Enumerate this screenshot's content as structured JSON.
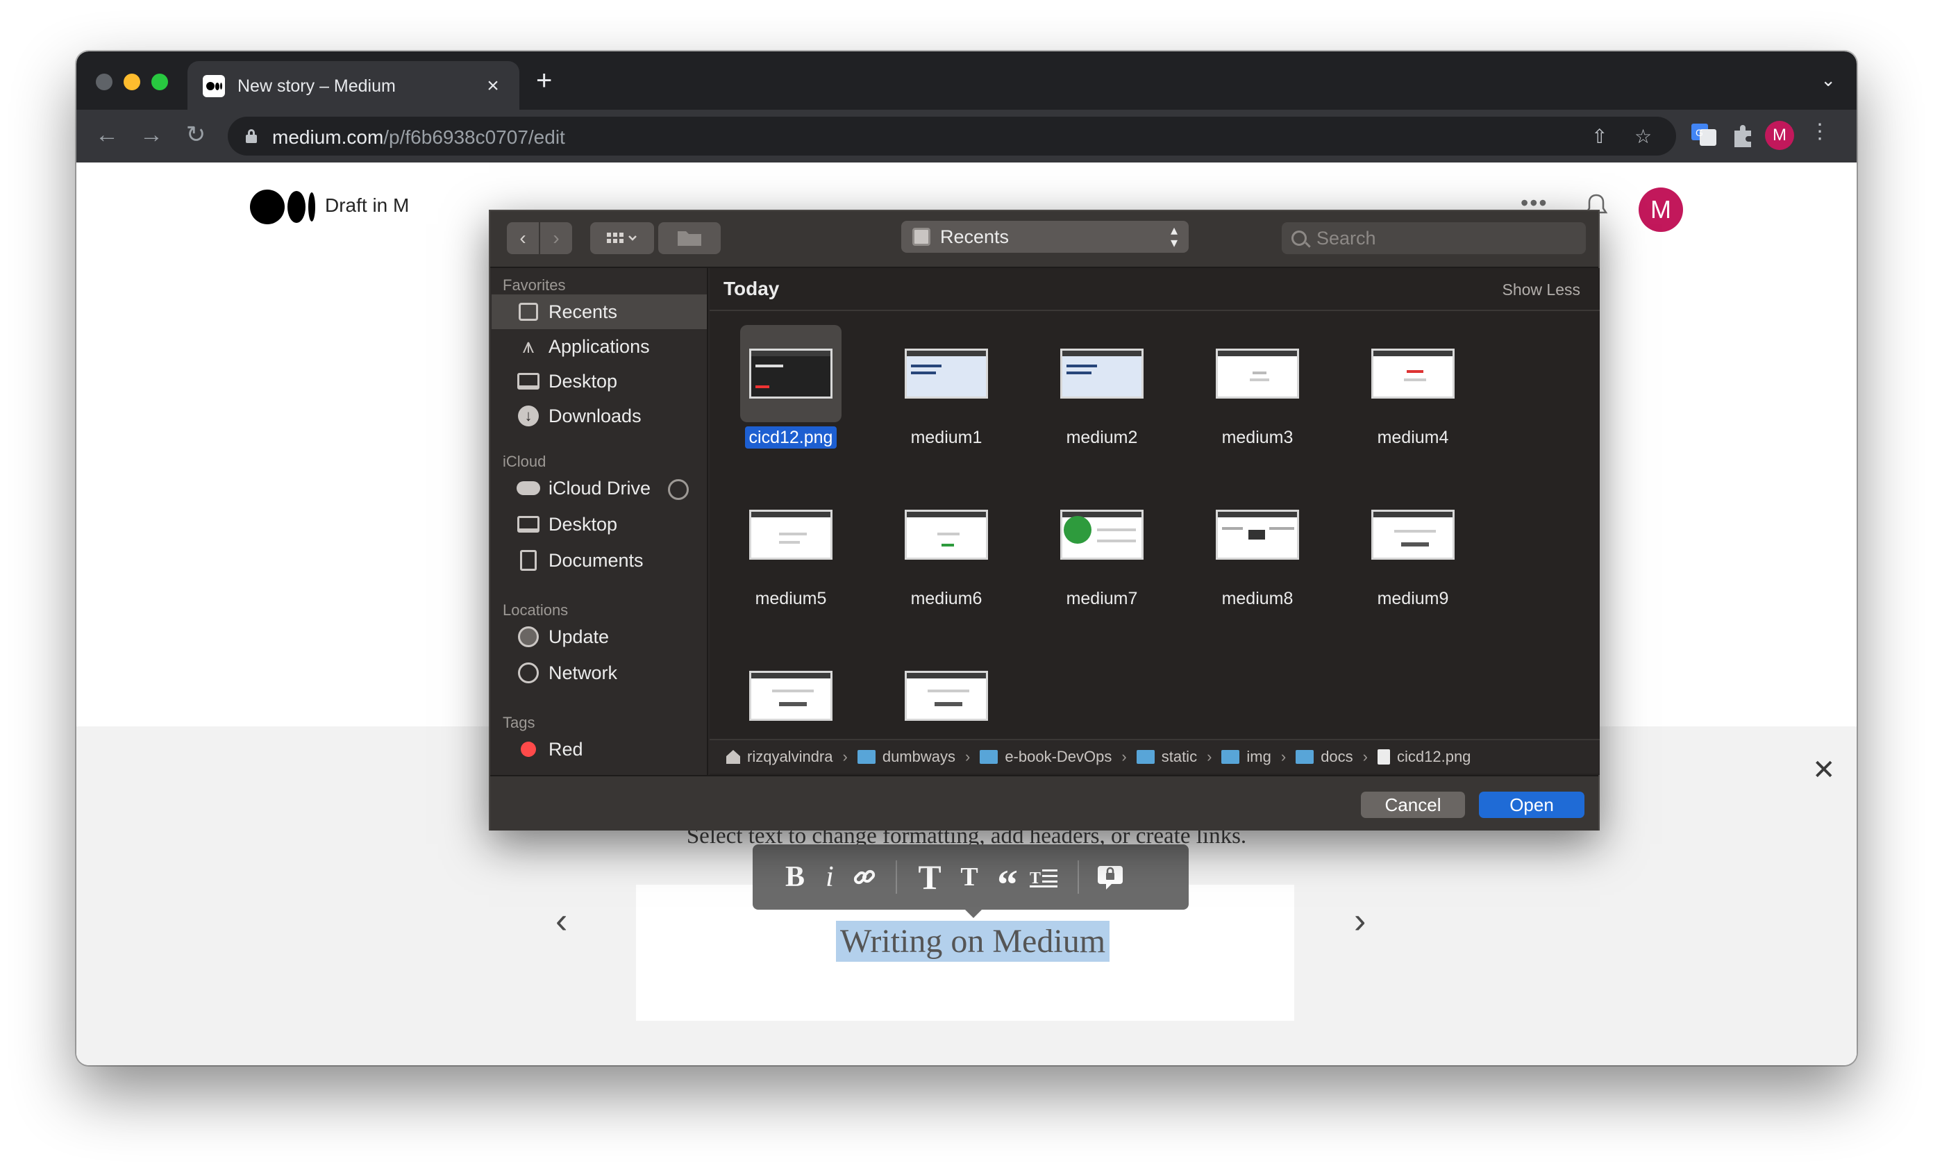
{
  "browser": {
    "tab_title": "New story – Medium",
    "url_host": "medium.com",
    "url_path": "/p/f6b6938c0707/edit",
    "profile_initial": "M"
  },
  "page": {
    "draft_label": "Draft in M",
    "avatar_initial": "M",
    "onboarding_hint": "Select text to change formatting, add headers, or create links.",
    "selected_text": "Writing on Medium",
    "format_buttons": [
      "B",
      "i",
      "T",
      "T",
      "“"
    ]
  },
  "dialog": {
    "location": "Recents",
    "search_placeholder": "Search",
    "section_title": "Today",
    "show_less": "Show Less",
    "sidebar": {
      "favorites_header": "Favorites",
      "favorites": [
        "Recents",
        "Applications",
        "Desktop",
        "Downloads"
      ],
      "icloud_header": "iCloud",
      "icloud": [
        "iCloud Drive",
        "Desktop",
        "Documents"
      ],
      "locations_header": "Locations",
      "locations": [
        "Update",
        "Network"
      ],
      "tags_header": "Tags",
      "tags": [
        "Red"
      ]
    },
    "files": [
      "cicd12.png",
      "medium1",
      "medium2",
      "medium3",
      "medium4",
      "medium5",
      "medium6",
      "medium7",
      "medium8",
      "medium9",
      "",
      ""
    ],
    "path": [
      "rizqyalvindra",
      "dumbways",
      "e-book-DevOps",
      "static",
      "img",
      "docs",
      "cicd12.png"
    ],
    "cancel_label": "Cancel",
    "open_label": "Open"
  }
}
